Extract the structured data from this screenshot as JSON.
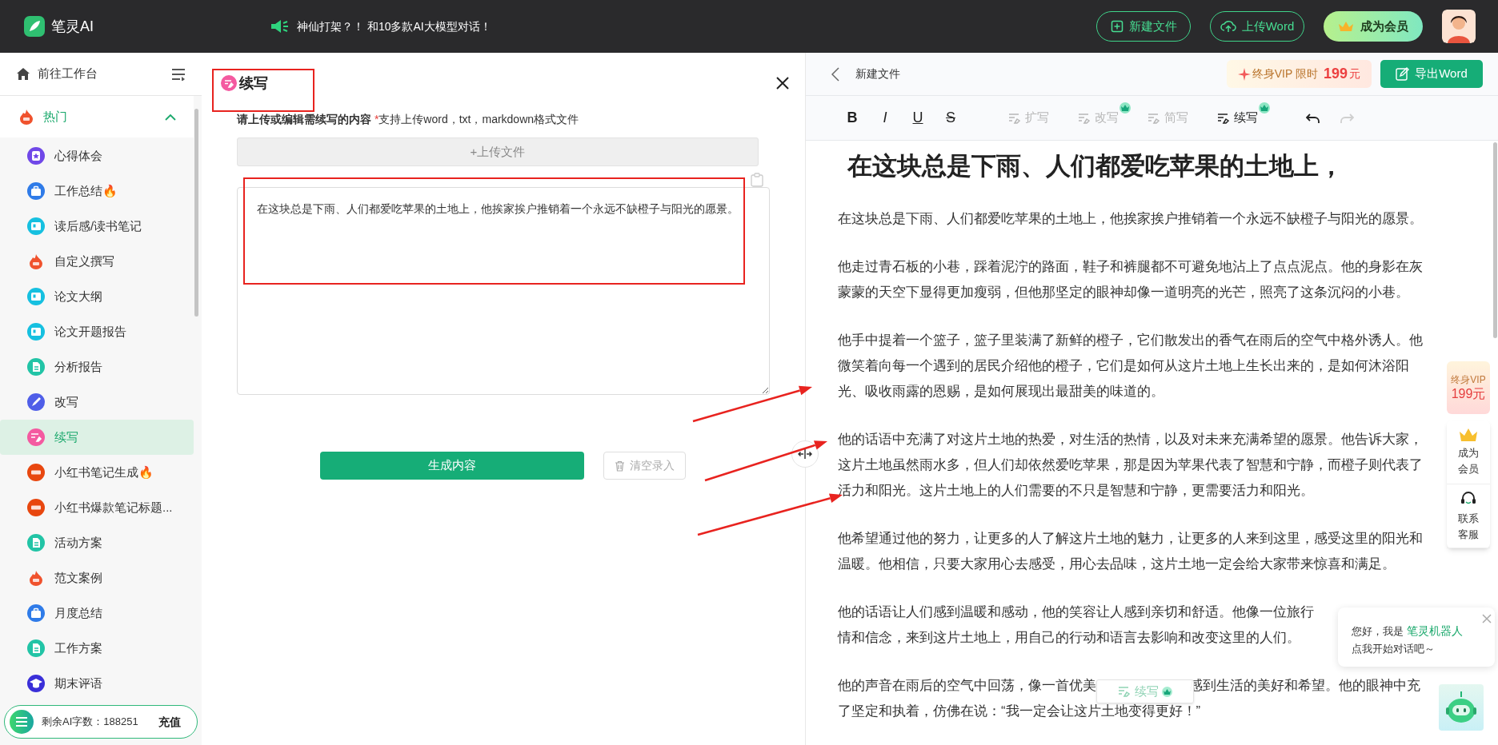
{
  "app": {
    "name": "笔灵AI"
  },
  "announcement": "神仙打架？！ 和10多款AI大模型对话！",
  "header_buttons": [
    {
      "label": "新建文件",
      "kind": "new"
    },
    {
      "label": "上传Word",
      "kind": "upload"
    },
    {
      "label": "成为会员",
      "kind": "vip"
    }
  ],
  "sidebar": {
    "workspace_link": "前往工作台",
    "groups": [
      {
        "label": "热门",
        "expanded": true,
        "items": [
          {
            "label": "心得体会",
            "kind": "star",
            "color": "#7048e8",
            "selected": false
          },
          {
            "label": "工作总结🔥",
            "kind": "briefcase",
            "color": "#2f7be8",
            "selected": false
          },
          {
            "label": "读后感/读书笔记",
            "kind": "book",
            "color": "#16c0e0",
            "selected": false
          },
          {
            "label": "自定义撰写",
            "kind": "fire",
            "color": "#f0522d",
            "selected": false
          },
          {
            "label": "论文大纲",
            "kind": "book",
            "color": "#16c0e0",
            "selected": false
          },
          {
            "label": "论文开题报告",
            "kind": "book",
            "color": "#16c0e0",
            "selected": false
          },
          {
            "label": "分析报告",
            "kind": "doc",
            "color": "#22c4a6",
            "selected": false
          },
          {
            "label": "改写",
            "kind": "pen",
            "color": "#4f5ee8",
            "selected": false
          },
          {
            "label": "续写",
            "kind": "edit",
            "color": "#f45aa0",
            "selected": true
          },
          {
            "label": "小红书笔记生成🔥",
            "kind": "badge",
            "color": "#e8470f",
            "selected": false
          },
          {
            "label": "小红书爆款笔记标题...",
            "kind": "badge",
            "color": "#e8470f",
            "selected": false
          },
          {
            "label": "活动方案",
            "kind": "doc",
            "color": "#22c4a6",
            "selected": false
          },
          {
            "label": "范文案例",
            "kind": "fire",
            "color": "#f0522d",
            "selected": false
          },
          {
            "label": "月度总结",
            "kind": "briefcase",
            "color": "#2f7be8",
            "selected": false
          },
          {
            "label": "工作方案",
            "kind": "doc",
            "color": "#22c4a6",
            "selected": false
          },
          {
            "label": "期末评语",
            "kind": "cap",
            "color": "#3a2fd8",
            "selected": false
          }
        ]
      }
    ],
    "quota": {
      "label": "剩余AI字数：188251",
      "action": "充值"
    }
  },
  "tool_panel": {
    "title": "续写",
    "prompt": "请上传或编辑需续写的内容",
    "required_mark": "*",
    "hint": "支持上传word，txt，markdown格式文件",
    "upload_button": "+上传文件",
    "content": "在这块总是下雨、人们都爱吃苹果的土地上，他挨家挨户推销着一个永远不缺橙子与阳光的愿景。",
    "generate_button": "生成内容",
    "clear_button": "清空录入"
  },
  "editor": {
    "file_name": "新建文件",
    "vip_offer": {
      "label": "终身VIP 限时",
      "price": "199",
      "unit": "元"
    },
    "export_button": "导出Word",
    "format_buttons": [
      {
        "label": "B",
        "kind": "bold"
      },
      {
        "label": "I",
        "kind": "italic"
      },
      {
        "label": "U",
        "kind": "underline"
      },
      {
        "label": "S",
        "kind": "strike"
      }
    ],
    "ai_tools": [
      {
        "label": "扩写",
        "disabled": true,
        "vip": false
      },
      {
        "label": "改写",
        "disabled": true,
        "vip": true
      },
      {
        "label": "简写",
        "disabled": true,
        "vip": false
      },
      {
        "label": "续写",
        "disabled": false,
        "vip": true
      }
    ],
    "history": [
      {
        "kind": "undo",
        "disabled": false
      },
      {
        "kind": "redo",
        "disabled": true
      }
    ],
    "document": {
      "title": "在这块总是下雨、人们都爱吃苹果的土地上，",
      "paragraphs": [
        {
          "lines": [
            [
              "在这块总是下雨、人们都爱吃苹果的土地上，他挨家挨户推销着一个永远不缺橙子与阳光的愿景。"
            ]
          ]
        },
        {
          "lines": [
            [
              "他走过青石板的小巷，踩着泥泞的路面，鞋子和裤腿都不可避免地沾上了点点泥点。他的身影在灰"
            ],
            [
              "蒙蒙的天空下显得更加瘦弱，但他那坚定的眼神却像一道明亮的光芒，照亮了这条沉闷的小巷。"
            ]
          ]
        },
        {
          "lines": [
            [
              "他手中提着一个篮子，篮子里装满了新鲜的橙子，它们散发出的香气在雨后的空气中格外诱人。他"
            ],
            [
              "微笑着向每一个遇到的居民介绍他的橙子，它们是如何从这片土地上生长出来的，是如何沐浴阳"
            ],
            [
              "光、吸收雨露的恩赐，是如何展现出最甜美的味道的。"
            ]
          ]
        },
        {
          "lines": [
            [
              "他的话语中充满了对这片土地的热爱，对生活的热情，以及对未来充满希望的愿景。他告诉大家，"
            ],
            [
              "这片土地虽然雨水多，但人们却依然爱吃苹果，那是因为苹果代表了智慧和宁静，而橙子则代表了"
            ],
            [
              "活力和阳光。这片土地上的人们需要的不只是智慧和宁静，更需要活力和阳光。"
            ]
          ]
        },
        {
          "lines": [
            [
              "他希望通过他的努力，让更多的人了解这片土地的魅力，让更多的人来到这里，感受这里的阳光和"
            ],
            [
              "温暖。他相信，只要大家用心去感受，用心去品味，这片土地一定会给大家带来惊喜和满足。"
            ]
          ]
        },
        {
          "lines": [
            [
              "他的话语让人们感到温暖和感动，他的笑容让人感到亲切和舒适。他像一位旅行"
            ],
            [
              "情和信念，来到这片土地上，用自己的行动和语言去影响和改变这里的人们。"
            ]
          ]
        },
        {
          "lines": [
            [
              "他的声音在雨后的空气中回荡，像一首优美",
              "感到生活的美好和希望。他的眼神中充"
            ],
            [
              "了坚定和执着，仿佛在说：“我一定会让这片土地变得更好！”"
            ]
          ]
        }
      ]
    },
    "floating_tool": {
      "label": "续写",
      "vip": true
    }
  },
  "side_widgets": [
    {
      "kind": "vip",
      "lines": [
        "终身VIP",
        "199元"
      ]
    },
    {
      "kind": "member",
      "label": "成为会员"
    },
    {
      "kind": "support",
      "label": "联系客服"
    }
  ],
  "chat_bubble": {
    "greeting": "您好，我是",
    "bot_name": "笔灵机器人",
    "prompt": "点我开始对话吧～"
  }
}
